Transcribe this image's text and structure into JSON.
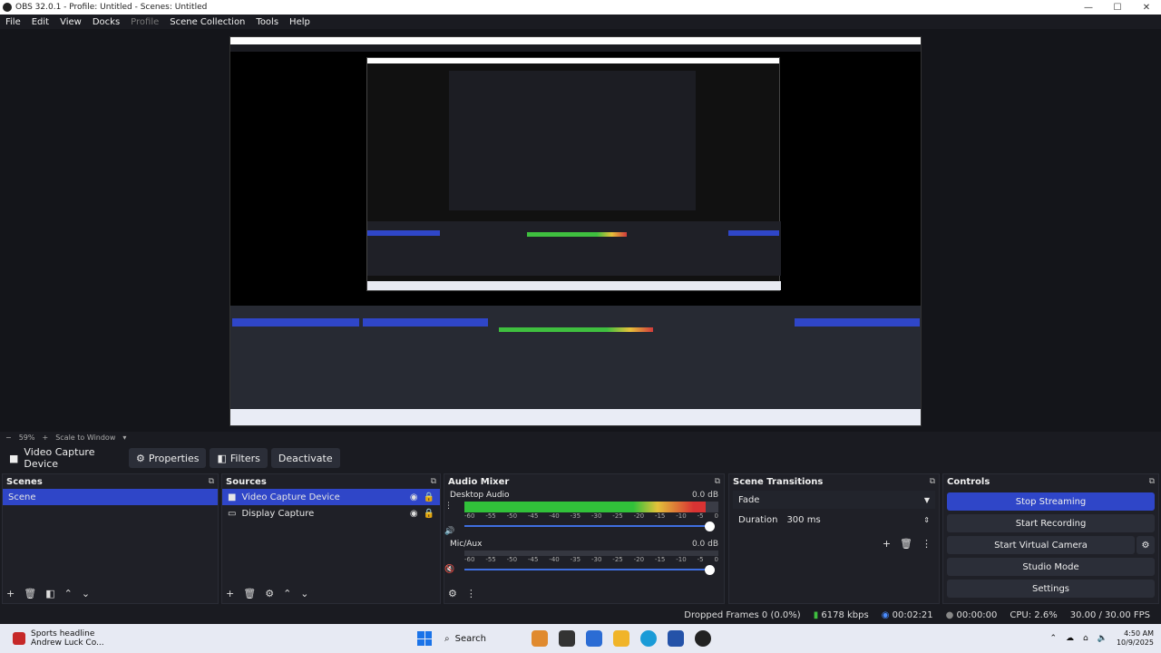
{
  "window": {
    "title": "OBS 32.0.1 - Profile: Untitled - Scenes: Untitled",
    "min": "—",
    "max": "☐",
    "close": "✕"
  },
  "menu": [
    "File",
    "Edit",
    "View",
    "Docks",
    "Profile",
    "Scene Collection",
    "Tools",
    "Help"
  ],
  "zoom": {
    "minus": "−",
    "level": "59%",
    "plus": "+",
    "mode": "Scale to Window",
    "arrow": "▾"
  },
  "source_toolbar": {
    "name": "Video Capture Device",
    "properties": "Properties",
    "filters": "Filters",
    "deactivate": "Deactivate"
  },
  "scenes": {
    "title": "Scenes",
    "items": [
      "Scene"
    ]
  },
  "sources": {
    "title": "Sources",
    "items": [
      {
        "name": "Video Capture Device"
      },
      {
        "name": "Display Capture"
      }
    ]
  },
  "mixer": {
    "title": "Audio Mixer",
    "channels": [
      {
        "name": "Desktop Audio",
        "db": "0.0 dB",
        "level": 0.95
      },
      {
        "name": "Mic/Aux",
        "db": "0.0 dB",
        "level": 0.0
      }
    ],
    "ticks": [
      "-60",
      "-55",
      "-50",
      "-45",
      "-40",
      "-35",
      "-30",
      "-25",
      "-20",
      "-15",
      "-10",
      "-5",
      "0"
    ]
  },
  "transitions": {
    "title": "Scene Transitions",
    "selected": "Fade",
    "duration_label": "Duration",
    "duration_value": "300 ms"
  },
  "controls": {
    "title": "Controls",
    "buttons": [
      "Stop Streaming",
      "Start Recording",
      "Start Virtual Camera",
      "Studio Mode",
      "Settings"
    ]
  },
  "status": {
    "dropped": "Dropped Frames 0 (0.0%)",
    "bitrate": "6178 kbps",
    "stream_time": "00:02:21",
    "rec_time": "00:00:00",
    "cpu": "CPU: 2.6%",
    "fps": "30.00 / 30.00 FPS"
  },
  "taskbar": {
    "news_title": "Sports headline",
    "news_sub": "Andrew Luck Co...",
    "search": "Search",
    "time": "4:50 AM",
    "date": "10/9/2025"
  },
  "colors": {
    "accent": "#2f46c8",
    "panel": "#1f2027",
    "bg": "#1a1b21"
  }
}
